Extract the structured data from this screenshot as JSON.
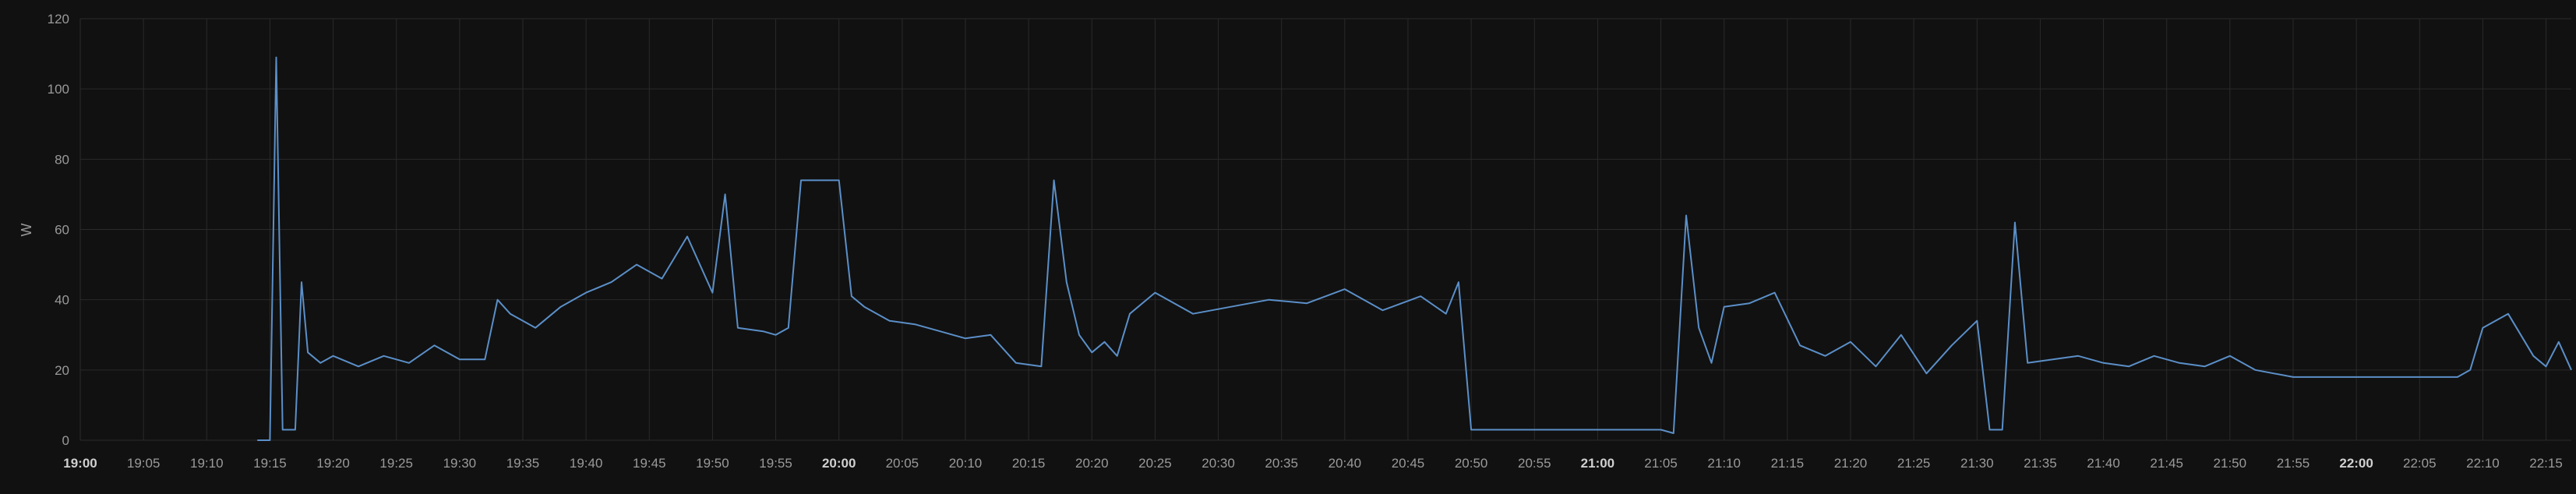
{
  "chart_data": {
    "type": "line",
    "title": "",
    "xlabel": "",
    "ylabel": "W",
    "ylim": [
      0,
      120
    ],
    "xlim": [
      "19:00",
      "22:17"
    ],
    "grid": true,
    "legend": "none",
    "y_ticks": [
      "0",
      "20",
      "40",
      "60",
      "80",
      "100",
      "120"
    ],
    "x_ticks": [
      {
        "label": "19:00",
        "bold": true
      },
      {
        "label": "19:05",
        "bold": false
      },
      {
        "label": "19:10",
        "bold": false
      },
      {
        "label": "19:15",
        "bold": false
      },
      {
        "label": "19:20",
        "bold": false
      },
      {
        "label": "19:25",
        "bold": false
      },
      {
        "label": "19:30",
        "bold": false
      },
      {
        "label": "19:35",
        "bold": false
      },
      {
        "label": "19:40",
        "bold": false
      },
      {
        "label": "19:45",
        "bold": false
      },
      {
        "label": "19:50",
        "bold": false
      },
      {
        "label": "19:55",
        "bold": false
      },
      {
        "label": "20:00",
        "bold": true
      },
      {
        "label": "20:05",
        "bold": false
      },
      {
        "label": "20:10",
        "bold": false
      },
      {
        "label": "20:15",
        "bold": false
      },
      {
        "label": "20:20",
        "bold": false
      },
      {
        "label": "20:25",
        "bold": false
      },
      {
        "label": "20:30",
        "bold": false
      },
      {
        "label": "20:35",
        "bold": false
      },
      {
        "label": "20:40",
        "bold": false
      },
      {
        "label": "20:45",
        "bold": false
      },
      {
        "label": "20:50",
        "bold": false
      },
      {
        "label": "20:55",
        "bold": false
      },
      {
        "label": "21:00",
        "bold": true
      },
      {
        "label": "21:05",
        "bold": false
      },
      {
        "label": "21:10",
        "bold": false
      },
      {
        "label": "21:15",
        "bold": false
      },
      {
        "label": "21:20",
        "bold": false
      },
      {
        "label": "21:25",
        "bold": false
      },
      {
        "label": "21:30",
        "bold": false
      },
      {
        "label": "21:35",
        "bold": false
      },
      {
        "label": "21:40",
        "bold": false
      },
      {
        "label": "21:45",
        "bold": false
      },
      {
        "label": "21:50",
        "bold": false
      },
      {
        "label": "21:55",
        "bold": false
      },
      {
        "label": "22:00",
        "bold": true
      },
      {
        "label": "22:05",
        "bold": false
      },
      {
        "label": "22:10",
        "bold": false
      },
      {
        "label": "22:15",
        "bold": false
      }
    ],
    "series": [
      {
        "color": "#5b8fc8",
        "x": [
          "19:14",
          "19:15",
          "19:15.5",
          "19:16",
          "19:17",
          "19:17.5",
          "19:18",
          "19:19",
          "19:20",
          "19:22",
          "19:24",
          "19:26",
          "19:28",
          "19:30",
          "19:32",
          "19:33",
          "19:34",
          "19:36",
          "19:38",
          "19:40",
          "19:42",
          "19:44",
          "19:46",
          "19:48",
          "19:50",
          "19:51",
          "19:52",
          "19:54",
          "19:55",
          "19:56",
          "19:57",
          "20:00",
          "20:01",
          "20:02",
          "20:04",
          "20:06",
          "20:08",
          "20:10",
          "20:12",
          "20:14",
          "20:16",
          "20:17",
          "20:18",
          "20:19",
          "20:20",
          "20:21",
          "20:22",
          "20:23",
          "20:25",
          "20:28",
          "20:31",
          "20:34",
          "20:37",
          "20:40",
          "20:43",
          "20:46",
          "20:48",
          "20:49",
          "20:50",
          "20:55",
          "21:00",
          "21:05",
          "21:06",
          "21:07",
          "21:08",
          "21:09",
          "21:10",
          "21:12",
          "21:14",
          "21:16",
          "21:18",
          "21:20",
          "21:22",
          "21:24",
          "21:26",
          "21:28",
          "21:30",
          "21:31",
          "21:32",
          "21:33",
          "21:34",
          "21:36",
          "21:38",
          "21:40",
          "21:42",
          "21:44",
          "21:46",
          "21:48",
          "21:50",
          "21:52",
          "21:55",
          "21:58",
          "22:00",
          "22:03",
          "22:06",
          "22:08",
          "22:09",
          "22:10",
          "22:12",
          "22:14",
          "22:15",
          "22:16",
          "22:17"
        ],
        "y": [
          0,
          0,
          109,
          3,
          3,
          45,
          25,
          22,
          24,
          21,
          24,
          22,
          27,
          23,
          23,
          40,
          36,
          32,
          38,
          42,
          45,
          50,
          46,
          58,
          42,
          70,
          32,
          31,
          30,
          32,
          74,
          74,
          41,
          38,
          34,
          33,
          31,
          29,
          30,
          22,
          21,
          74,
          45,
          30,
          25,
          28,
          24,
          36,
          42,
          36,
          38,
          40,
          39,
          43,
          37,
          41,
          36,
          45,
          3,
          3,
          3,
          3,
          2,
          64,
          32,
          22,
          38,
          39,
          42,
          27,
          24,
          28,
          21,
          30,
          19,
          27,
          34,
          3,
          3,
          62,
          22,
          23,
          24,
          22,
          21,
          24,
          22,
          21,
          24,
          20,
          18,
          18,
          18,
          18,
          18,
          18,
          20,
          32,
          36,
          24,
          21,
          28,
          20
        ]
      }
    ]
  }
}
